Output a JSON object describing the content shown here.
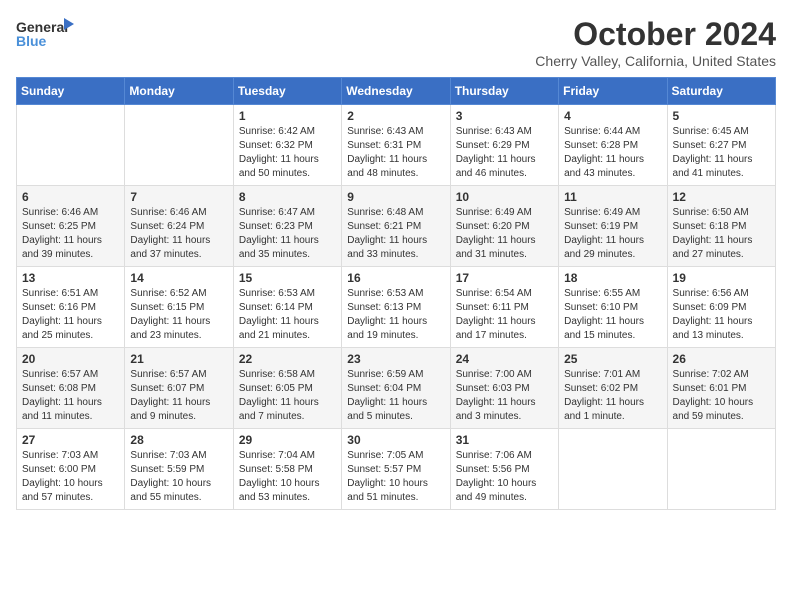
{
  "logo": {
    "general": "General",
    "blue": "Blue"
  },
  "title": "October 2024",
  "location": "Cherry Valley, California, United States",
  "weekdays": [
    "Sunday",
    "Monday",
    "Tuesday",
    "Wednesday",
    "Thursday",
    "Friday",
    "Saturday"
  ],
  "weeks": [
    [
      {
        "day": "",
        "sunrise": "",
        "sunset": "",
        "daylight": ""
      },
      {
        "day": "",
        "sunrise": "",
        "sunset": "",
        "daylight": ""
      },
      {
        "day": "1",
        "sunrise": "Sunrise: 6:42 AM",
        "sunset": "Sunset: 6:32 PM",
        "daylight": "Daylight: 11 hours and 50 minutes."
      },
      {
        "day": "2",
        "sunrise": "Sunrise: 6:43 AM",
        "sunset": "Sunset: 6:31 PM",
        "daylight": "Daylight: 11 hours and 48 minutes."
      },
      {
        "day": "3",
        "sunrise": "Sunrise: 6:43 AM",
        "sunset": "Sunset: 6:29 PM",
        "daylight": "Daylight: 11 hours and 46 minutes."
      },
      {
        "day": "4",
        "sunrise": "Sunrise: 6:44 AM",
        "sunset": "Sunset: 6:28 PM",
        "daylight": "Daylight: 11 hours and 43 minutes."
      },
      {
        "day": "5",
        "sunrise": "Sunrise: 6:45 AM",
        "sunset": "Sunset: 6:27 PM",
        "daylight": "Daylight: 11 hours and 41 minutes."
      }
    ],
    [
      {
        "day": "6",
        "sunrise": "Sunrise: 6:46 AM",
        "sunset": "Sunset: 6:25 PM",
        "daylight": "Daylight: 11 hours and 39 minutes."
      },
      {
        "day": "7",
        "sunrise": "Sunrise: 6:46 AM",
        "sunset": "Sunset: 6:24 PM",
        "daylight": "Daylight: 11 hours and 37 minutes."
      },
      {
        "day": "8",
        "sunrise": "Sunrise: 6:47 AM",
        "sunset": "Sunset: 6:23 PM",
        "daylight": "Daylight: 11 hours and 35 minutes."
      },
      {
        "day": "9",
        "sunrise": "Sunrise: 6:48 AM",
        "sunset": "Sunset: 6:21 PM",
        "daylight": "Daylight: 11 hours and 33 minutes."
      },
      {
        "day": "10",
        "sunrise": "Sunrise: 6:49 AM",
        "sunset": "Sunset: 6:20 PM",
        "daylight": "Daylight: 11 hours and 31 minutes."
      },
      {
        "day": "11",
        "sunrise": "Sunrise: 6:49 AM",
        "sunset": "Sunset: 6:19 PM",
        "daylight": "Daylight: 11 hours and 29 minutes."
      },
      {
        "day": "12",
        "sunrise": "Sunrise: 6:50 AM",
        "sunset": "Sunset: 6:18 PM",
        "daylight": "Daylight: 11 hours and 27 minutes."
      }
    ],
    [
      {
        "day": "13",
        "sunrise": "Sunrise: 6:51 AM",
        "sunset": "Sunset: 6:16 PM",
        "daylight": "Daylight: 11 hours and 25 minutes."
      },
      {
        "day": "14",
        "sunrise": "Sunrise: 6:52 AM",
        "sunset": "Sunset: 6:15 PM",
        "daylight": "Daylight: 11 hours and 23 minutes."
      },
      {
        "day": "15",
        "sunrise": "Sunrise: 6:53 AM",
        "sunset": "Sunset: 6:14 PM",
        "daylight": "Daylight: 11 hours and 21 minutes."
      },
      {
        "day": "16",
        "sunrise": "Sunrise: 6:53 AM",
        "sunset": "Sunset: 6:13 PM",
        "daylight": "Daylight: 11 hours and 19 minutes."
      },
      {
        "day": "17",
        "sunrise": "Sunrise: 6:54 AM",
        "sunset": "Sunset: 6:11 PM",
        "daylight": "Daylight: 11 hours and 17 minutes."
      },
      {
        "day": "18",
        "sunrise": "Sunrise: 6:55 AM",
        "sunset": "Sunset: 6:10 PM",
        "daylight": "Daylight: 11 hours and 15 minutes."
      },
      {
        "day": "19",
        "sunrise": "Sunrise: 6:56 AM",
        "sunset": "Sunset: 6:09 PM",
        "daylight": "Daylight: 11 hours and 13 minutes."
      }
    ],
    [
      {
        "day": "20",
        "sunrise": "Sunrise: 6:57 AM",
        "sunset": "Sunset: 6:08 PM",
        "daylight": "Daylight: 11 hours and 11 minutes."
      },
      {
        "day": "21",
        "sunrise": "Sunrise: 6:57 AM",
        "sunset": "Sunset: 6:07 PM",
        "daylight": "Daylight: 11 hours and 9 minutes."
      },
      {
        "day": "22",
        "sunrise": "Sunrise: 6:58 AM",
        "sunset": "Sunset: 6:05 PM",
        "daylight": "Daylight: 11 hours and 7 minutes."
      },
      {
        "day": "23",
        "sunrise": "Sunrise: 6:59 AM",
        "sunset": "Sunset: 6:04 PM",
        "daylight": "Daylight: 11 hours and 5 minutes."
      },
      {
        "day": "24",
        "sunrise": "Sunrise: 7:00 AM",
        "sunset": "Sunset: 6:03 PM",
        "daylight": "Daylight: 11 hours and 3 minutes."
      },
      {
        "day": "25",
        "sunrise": "Sunrise: 7:01 AM",
        "sunset": "Sunset: 6:02 PM",
        "daylight": "Daylight: 11 hours and 1 minute."
      },
      {
        "day": "26",
        "sunrise": "Sunrise: 7:02 AM",
        "sunset": "Sunset: 6:01 PM",
        "daylight": "Daylight: 10 hours and 59 minutes."
      }
    ],
    [
      {
        "day": "27",
        "sunrise": "Sunrise: 7:03 AM",
        "sunset": "Sunset: 6:00 PM",
        "daylight": "Daylight: 10 hours and 57 minutes."
      },
      {
        "day": "28",
        "sunrise": "Sunrise: 7:03 AM",
        "sunset": "Sunset: 5:59 PM",
        "daylight": "Daylight: 10 hours and 55 minutes."
      },
      {
        "day": "29",
        "sunrise": "Sunrise: 7:04 AM",
        "sunset": "Sunset: 5:58 PM",
        "daylight": "Daylight: 10 hours and 53 minutes."
      },
      {
        "day": "30",
        "sunrise": "Sunrise: 7:05 AM",
        "sunset": "Sunset: 5:57 PM",
        "daylight": "Daylight: 10 hours and 51 minutes."
      },
      {
        "day": "31",
        "sunrise": "Sunrise: 7:06 AM",
        "sunset": "Sunset: 5:56 PM",
        "daylight": "Daylight: 10 hours and 49 minutes."
      },
      {
        "day": "",
        "sunrise": "",
        "sunset": "",
        "daylight": ""
      },
      {
        "day": "",
        "sunrise": "",
        "sunset": "",
        "daylight": ""
      }
    ]
  ]
}
